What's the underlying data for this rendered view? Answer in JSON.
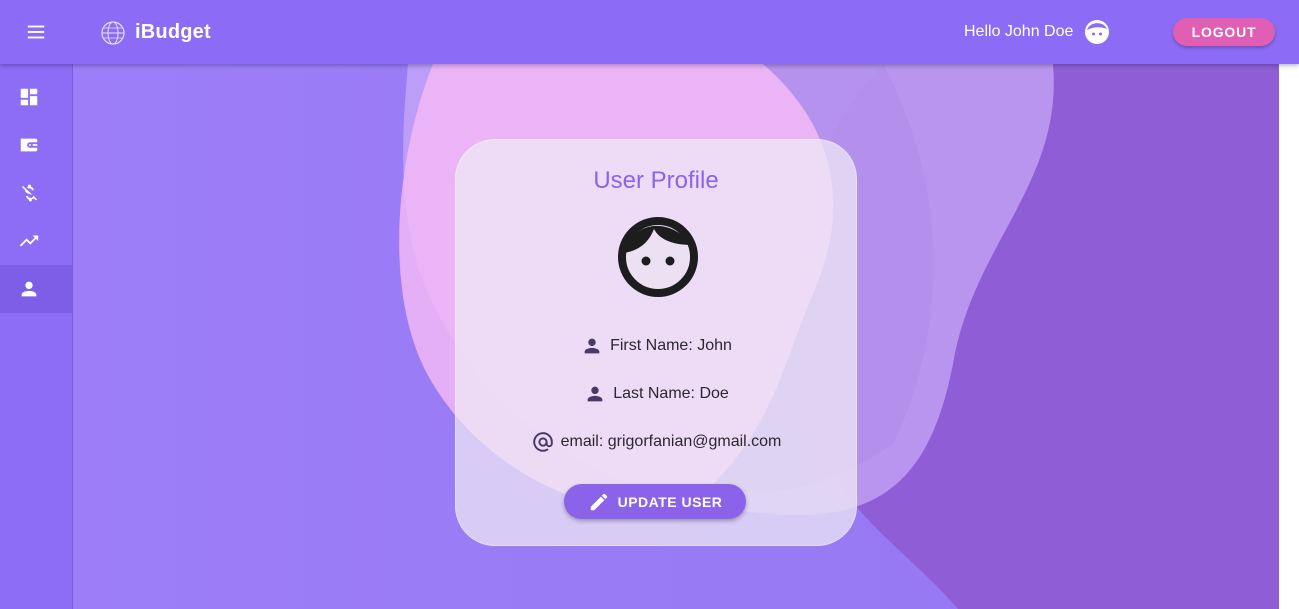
{
  "appbar": {
    "title": "iBudget",
    "greeting": "Hello John Doe",
    "logout_label": "LOGOUT",
    "icons": [
      "menu-icon",
      "globe-logo-icon",
      "face-avatar-icon"
    ]
  },
  "sidebar": {
    "items": [
      {
        "id": "dashboard",
        "icon": "dashboard-icon",
        "active": false
      },
      {
        "id": "wallet",
        "icon": "wallet-icon",
        "active": false
      },
      {
        "id": "expenses",
        "icon": "money-off-icon",
        "active": false
      },
      {
        "id": "trends",
        "icon": "trending-up-icon",
        "active": false
      },
      {
        "id": "profile",
        "icon": "person-icon",
        "active": true
      }
    ]
  },
  "profile": {
    "title": "User Profile",
    "first_name": "First Name: John",
    "last_name": "Last Name: Doe",
    "email": "email: grigorfanian@gmail.com",
    "update_label": "UPDATE USER"
  },
  "colors": {
    "appbar": "#8c6cf6",
    "logout": "#e05fb5",
    "accent": "#8a63ea",
    "card": "#f0ebf5"
  }
}
